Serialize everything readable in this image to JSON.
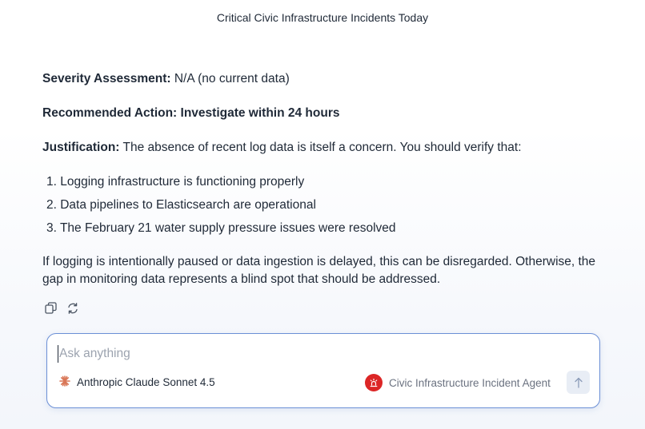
{
  "header": {
    "title": "Critical Civic Infrastructure Incidents Today"
  },
  "message": {
    "severity_label": "Severity Assessment:",
    "severity_value": " N/A (no current data)",
    "action_label": "Recommended Action: Investigate within 24 hours",
    "justification_label": "Justification:",
    "justification_text": " The absence of recent log data is itself a concern. You should verify that:",
    "list": [
      "1. Logging infrastructure is functioning properly",
      "2. Data pipelines to Elasticsearch are operational",
      "3. The February 21 water supply pressure issues were resolved"
    ],
    "closing": "If logging is intentionally paused or data ingestion is delayed, this can be disregarded. Otherwise, the gap in monitoring data represents a blind spot that should be addressed."
  },
  "actions": {
    "copy_icon": "copy-icon",
    "regenerate_icon": "regenerate-icon"
  },
  "composer": {
    "placeholder": "Ask anything",
    "model_name": "Anthropic Claude Sonnet 4.5",
    "agent_name": "Civic Infrastructure Incident Agent",
    "model_icon": "anthropic-logo-icon",
    "agent_icon": "alert-icon",
    "send_icon": "arrow-up-icon"
  },
  "colors": {
    "accent_border": "#6b8fd6",
    "agent_badge": "#dc2626",
    "model_logo": "#d97757"
  }
}
